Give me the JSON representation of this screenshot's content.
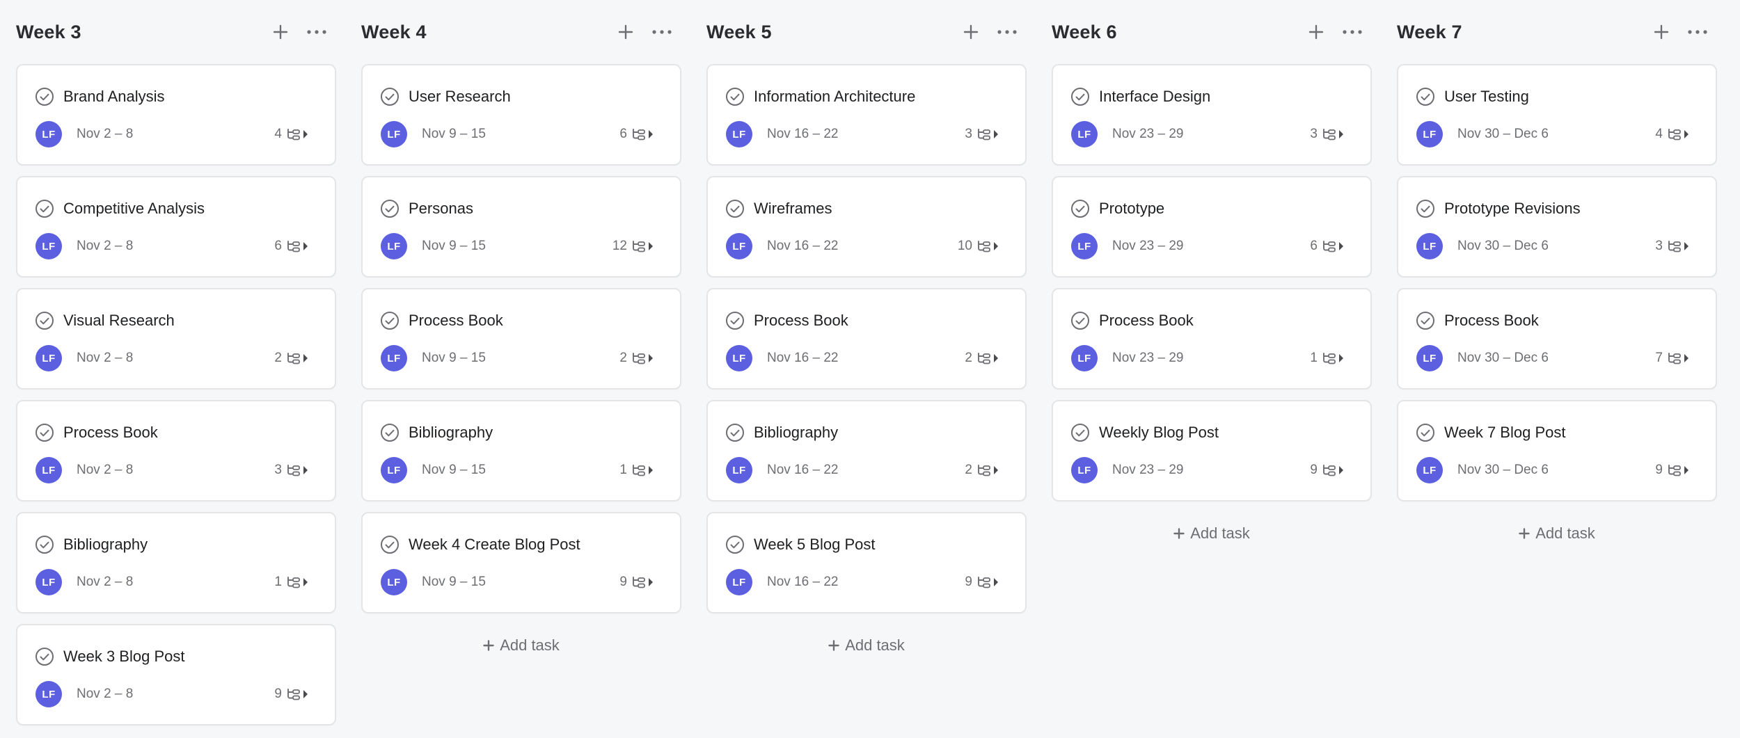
{
  "colors": {
    "avatar": "#5b5fe0",
    "card_border": "#e4e5e7",
    "background": "#f6f7f9"
  },
  "add_task_label": "Add task",
  "columns": [
    {
      "title": "Week 3",
      "tasks": [
        {
          "name": "Brand Analysis",
          "assignee": "LF",
          "date": "Nov 2 – 8",
          "subtasks": "4"
        },
        {
          "name": "Competitive Analysis",
          "assignee": "LF",
          "date": "Nov 2 – 8",
          "subtasks": "6"
        },
        {
          "name": "Visual Research",
          "assignee": "LF",
          "date": "Nov 2 – 8",
          "subtasks": "2"
        },
        {
          "name": "Process Book",
          "assignee": "LF",
          "date": "Nov 2 – 8",
          "subtasks": "3"
        },
        {
          "name": "Bibliography",
          "assignee": "LF",
          "date": "Nov 2 – 8",
          "subtasks": "1"
        },
        {
          "name": "Week 3 Blog Post",
          "assignee": "LF",
          "date": "Nov 2 – 8",
          "subtasks": "9"
        }
      ]
    },
    {
      "title": "Week 4",
      "tasks": [
        {
          "name": "User Research",
          "assignee": "LF",
          "date": "Nov 9 – 15",
          "subtasks": "6"
        },
        {
          "name": "Personas",
          "assignee": "LF",
          "date": "Nov 9 – 15",
          "subtasks": "12"
        },
        {
          "name": "Process Book",
          "assignee": "LF",
          "date": "Nov 9 – 15",
          "subtasks": "2"
        },
        {
          "name": "Bibliography",
          "assignee": "LF",
          "date": "Nov 9 – 15",
          "subtasks": "1"
        },
        {
          "name": "Week 4 Create Blog Post",
          "assignee": "LF",
          "date": "Nov 9 – 15",
          "subtasks": "9"
        }
      ]
    },
    {
      "title": "Week 5",
      "tasks": [
        {
          "name": "Information Architecture",
          "assignee": "LF",
          "date": "Nov 16 – 22",
          "subtasks": "3"
        },
        {
          "name": "Wireframes",
          "assignee": "LF",
          "date": "Nov 16 – 22",
          "subtasks": "10"
        },
        {
          "name": "Process Book",
          "assignee": "LF",
          "date": "Nov 16 – 22",
          "subtasks": "2"
        },
        {
          "name": "Bibliography",
          "assignee": "LF",
          "date": "Nov 16 – 22",
          "subtasks": "2"
        },
        {
          "name": "Week 5 Blog Post",
          "assignee": "LF",
          "date": "Nov 16 – 22",
          "subtasks": "9"
        }
      ]
    },
    {
      "title": "Week 6",
      "tasks": [
        {
          "name": "Interface Design",
          "assignee": "LF",
          "date": "Nov 23 – 29",
          "subtasks": "3"
        },
        {
          "name": "Prototype",
          "assignee": "LF",
          "date": "Nov 23 – 29",
          "subtasks": "6"
        },
        {
          "name": "Process Book",
          "assignee": "LF",
          "date": "Nov 23 – 29",
          "subtasks": "1"
        },
        {
          "name": "Weekly Blog Post",
          "assignee": "LF",
          "date": "Nov 23 – 29",
          "subtasks": "9"
        }
      ]
    },
    {
      "title": "Week 7",
      "tasks": [
        {
          "name": "User Testing",
          "assignee": "LF",
          "date": "Nov 30 – Dec 6",
          "subtasks": "4"
        },
        {
          "name": "Prototype Revisions",
          "assignee": "LF",
          "date": "Nov 30 – Dec 6",
          "subtasks": "3"
        },
        {
          "name": "Process Book",
          "assignee": "LF",
          "date": "Nov 30 – Dec 6",
          "subtasks": "7"
        },
        {
          "name": "Week 7 Blog Post",
          "assignee": "LF",
          "date": "Nov 30 – Dec 6",
          "subtasks": "9"
        }
      ]
    }
  ]
}
